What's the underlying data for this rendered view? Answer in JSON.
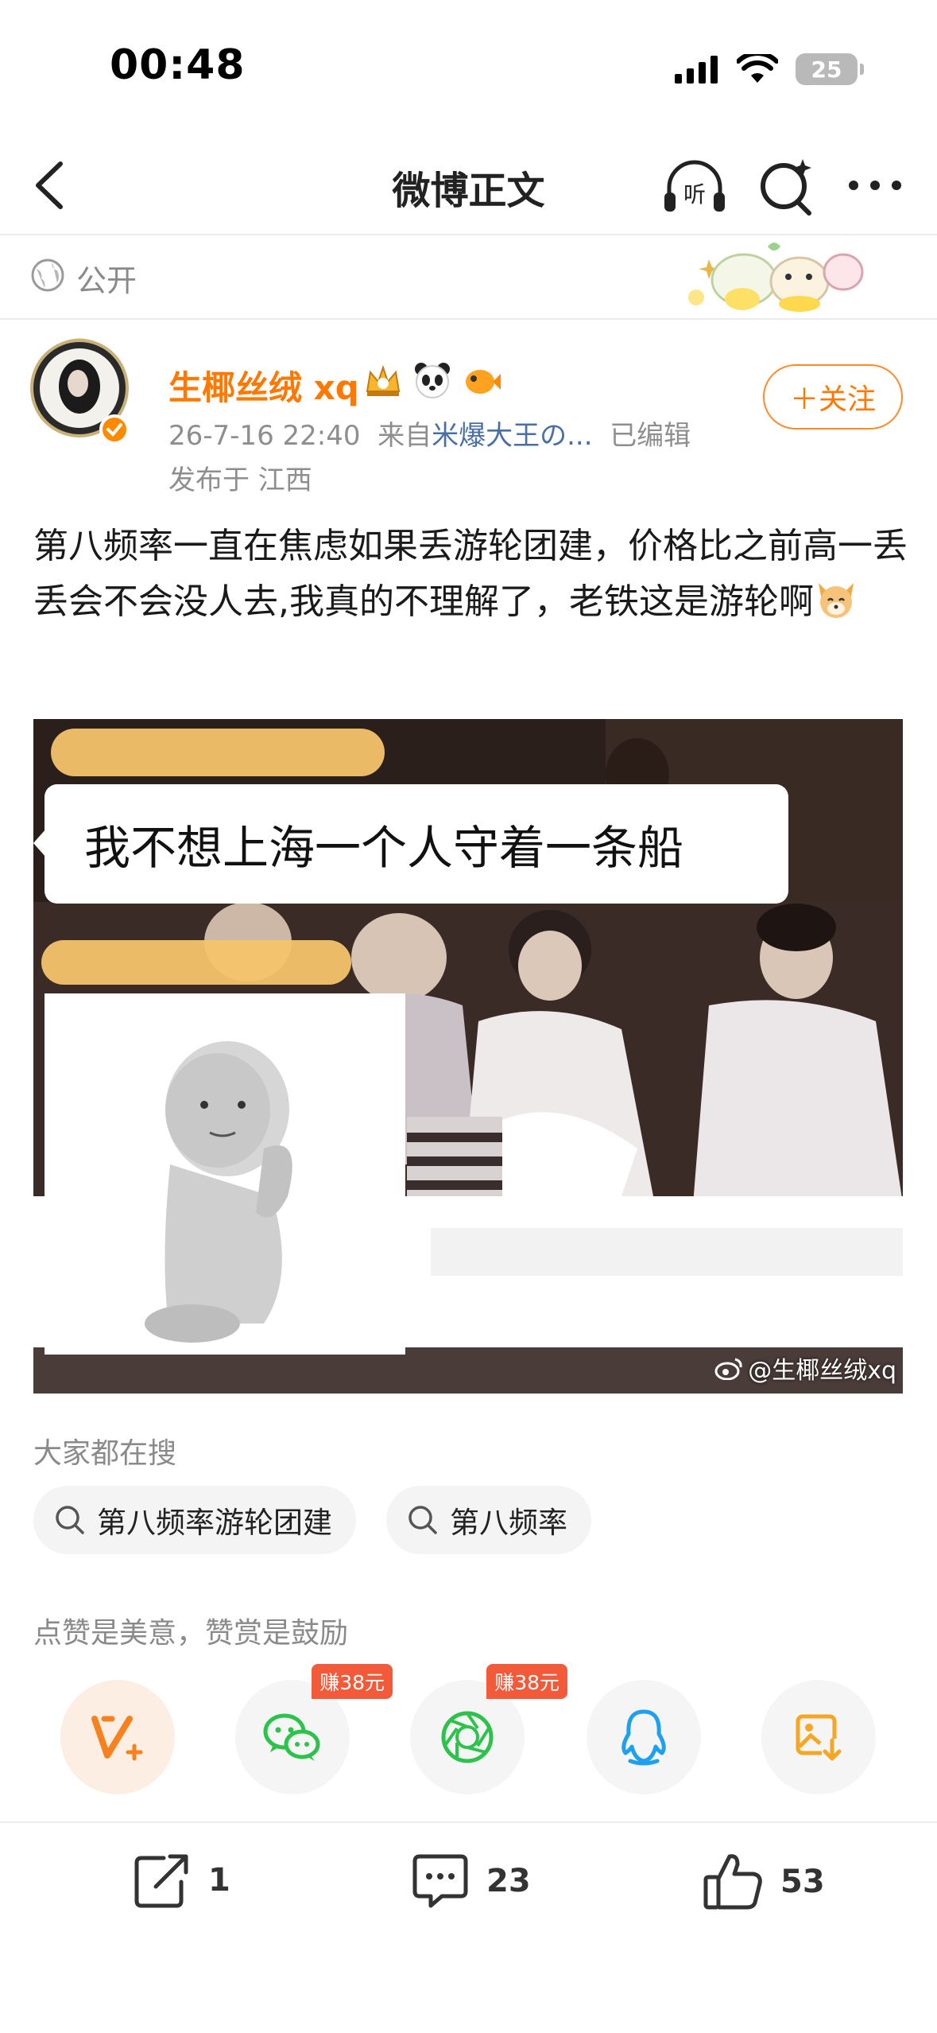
{
  "status_bar": {
    "time": "00:48",
    "battery": "25"
  },
  "nav": {
    "title": "微博正文",
    "listen_label": "听"
  },
  "visibility": {
    "label": "公开"
  },
  "author": {
    "name": "生椰丝绒 xq",
    "timestamp": "26-7-16 22:40",
    "source_prefix": "来自",
    "source": "米爆大王の...",
    "edited": "已编辑",
    "location": "发布于 江西",
    "follow_label": "＋关注"
  },
  "post": {
    "text_before_emoji": "第八频率一直在焦虑如果丢游轮团建，价格比之前高一丢丢会不会没人去,我真的不理解了，老铁这是游轮啊",
    "image_caption": "我不想上海一个人守着一条船",
    "watermark": "@生椰丝绒xq"
  },
  "trending": {
    "label": "大家都在搜",
    "chips": [
      "第八频率游轮团建",
      "第八频率"
    ]
  },
  "reward": {
    "label": "点赞是美意，赞赏是鼓励"
  },
  "share": {
    "earn_tag_1": "赚38元",
    "earn_tag_2": "赚38元"
  },
  "actions": {
    "reposts": "1",
    "comments": "23",
    "likes": "53"
  },
  "colors": {
    "accent": "#ff7800",
    "source_link": "#4a6fa5",
    "earn_tag": "#f25a3a"
  }
}
